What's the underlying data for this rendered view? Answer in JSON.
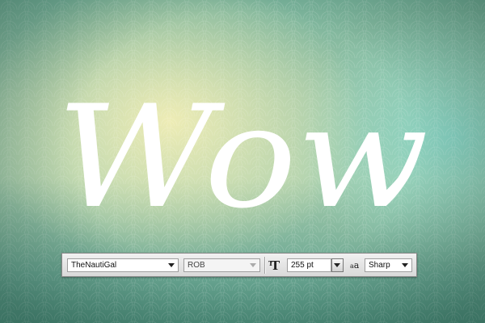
{
  "artwork": {
    "word": "Wow"
  },
  "character_toolbar": {
    "font_family": "TheNautiGal",
    "font_style": "ROB",
    "font_size": "255 pt",
    "anti_alias": "Sharp"
  }
}
